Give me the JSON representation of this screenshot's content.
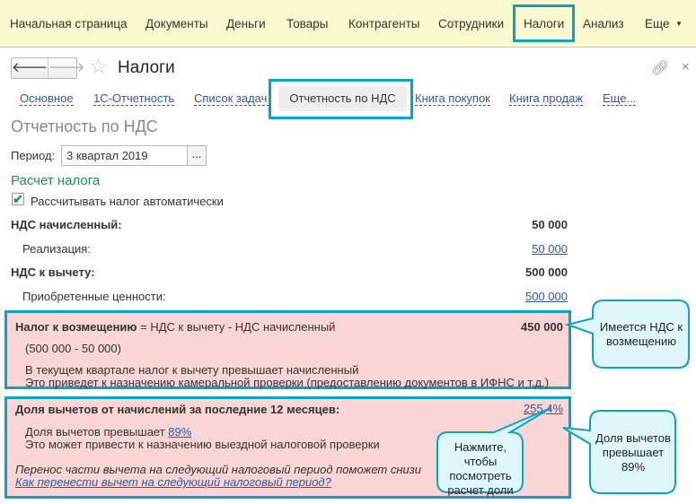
{
  "menu": {
    "items": [
      "Начальная страница",
      "Документы",
      "Деньги",
      "Товары",
      "Контрагенты",
      "Сотрудники",
      "Налоги",
      "Анализ",
      "Еще"
    ],
    "active": "Налоги"
  },
  "header": {
    "title": "Налоги",
    "back_icon": "arrow-left",
    "forward_icon": "arrow-right",
    "star_icon": "star",
    "link_icon": "link",
    "close_icon": "close"
  },
  "tabs": {
    "items": [
      "Основное",
      "1С-Отчетность",
      "Список задач",
      "Отчетность по НДС",
      "Книга покупок",
      "Книга продаж",
      "Еще..."
    ],
    "active": "Отчетность по НДС"
  },
  "page": {
    "heading": "Отчетность по НДС",
    "period_label": "Период:",
    "period_value": "3 квартал 2019",
    "period_button": "...",
    "section": "Расчет налога",
    "auto_checkbox": "Рассчитывать налог автоматически",
    "auto_checked": true,
    "rows": [
      {
        "label": "НДС начисленный:",
        "value": "50 000"
      },
      {
        "label": "Реализация:",
        "value": "50 000"
      },
      {
        "label": "НДС к вычету:",
        "value": "500 000"
      },
      {
        "label": "Приобретенные ценности:",
        "value": "500 000"
      }
    ]
  },
  "refund": {
    "title_bold": "Налог к возмещению",
    "title_rest": " = НДС к вычету - НДС начисленный",
    "value": "450 000",
    "calc": "(500 000 - 50 000)",
    "line1": "В текущем квартале налог к вычету превышает начисленный",
    "line2": "Это приведет к назначению камеральной проверки (предоставлению документов в ИФНС и т.д.)"
  },
  "share": {
    "title": "Доля вычетов от начислений за последние 12 месяцев:",
    "value": "255,4%",
    "line1": "Доля вычетов превышает ",
    "line1_link": "89%",
    "line2": "Это может привести к назначению выездной налоговой проверки",
    "hint": "Перенос части вычета на следующий налоговый период поможет снизи",
    "hint_link": "Как перенести вычет на следующий налоговый период?"
  },
  "callouts": {
    "refund": "Имеется НДС к возмещению",
    "click": "Нажмите, чтобы посмотреть расчет доли",
    "share": "Доля вычетов превышает 89%"
  },
  "colors": {
    "highlight": "#0aa3c2",
    "alert_bg": "#f9d6d5",
    "callout_bg": "#dff7fb",
    "accent_green": "#1d8f5c",
    "link": "#2c5aa0"
  }
}
